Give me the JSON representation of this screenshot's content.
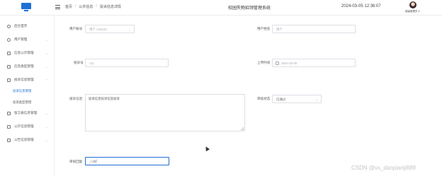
{
  "header": {
    "breadcrumb": [
      "首页",
      "公共信息",
      "投诉信息详情"
    ],
    "breadcrumb_sep": "/",
    "app_title": "校园失物招领管理系统",
    "datetime": "2024-03-05 12:36:07",
    "user_name": "超级管理员 ▾"
  },
  "sidebar": {
    "items": [
      {
        "label": "后台首页",
        "icon": "clock-icon",
        "chevron": ""
      },
      {
        "label": "用户管理",
        "icon": "user-icon",
        "chevron": "⌄"
      },
      {
        "label": "信息公示管理",
        "icon": "doc-icon",
        "chevron": "⌄"
      },
      {
        "label": "信息类型管理",
        "icon": "doc-icon",
        "chevron": "⌄"
      },
      {
        "label": "投诉信息管理",
        "icon": "doc-icon",
        "chevron": "⌃"
      }
    ],
    "sub_items": [
      {
        "label": "投诉信息管理",
        "active": true
      },
      {
        "label": "投诉类型管理",
        "active": false
      }
    ],
    "items_after": [
      {
        "label": "留言板信息管理",
        "icon": "chat-icon",
        "chevron": "⌄"
      },
      {
        "label": "公示信息管理",
        "icon": "doc-icon",
        "chevron": "⌄"
      },
      {
        "label": "公告信息管理",
        "icon": "doc-icon",
        "chevron": "⌄"
      }
    ]
  },
  "form": {
    "user_account_label": "用户账号",
    "user_account_value": "用户 123123",
    "user_name_label": "用户姓名",
    "user_name_value": "用户",
    "complaint_no_label": "投诉号",
    "complaint_no_value": "111",
    "upload_date_label": "上传时间",
    "upload_date_value": "2024-03-05",
    "content_label": "投诉信息",
    "content_value": "投诉信息投诉信息投诉",
    "status_label": "审核状态",
    "status_value": "已通过",
    "reply_label": "审核回复",
    "reply_value": "ノ2好"
  },
  "watermark": "CSDN @vx_danpianji889",
  "icons": {
    "arrow": "⌄"
  }
}
